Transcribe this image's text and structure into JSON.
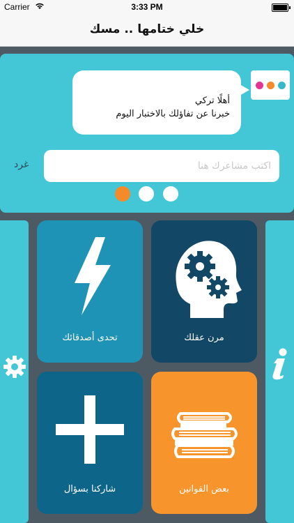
{
  "status_bar": {
    "carrier": "Carrier",
    "time": "3:33 PM"
  },
  "nav": {
    "title": "خلي ختامها .. مسك"
  },
  "feed": {
    "greeting": "أهلًا تركي",
    "message": "خبرنا عن تفاؤلك بالاختبار اليوم",
    "input_placeholder": "اكتب مشاعرك هنا",
    "input_value": "",
    "tweet_label": "غرد",
    "pager_total": 3,
    "pager_active": 1
  },
  "tiles": {
    "challenge_friends": "تحدى أصدقائك",
    "train_mind": "مرن عقلك",
    "ask_question": "شاركنا بسؤال",
    "some_rules": "بعض القوانين"
  },
  "colors": {
    "panel": "#43c7d6",
    "challenge_tile": "#1f93b6",
    "brain_tile": "#134766",
    "ask_tile": "#0d6689",
    "rules_tile": "#f7952c",
    "active_page_dot": "#f48a2a",
    "background": "#4d5a63"
  },
  "icons": {
    "left_sidebar": "gear-icon",
    "right_sidebar": "info-icon",
    "challenge": "lightning-icon",
    "brain": "brain-gears-icon",
    "ask": "plus-icon",
    "rules": "books-icon"
  }
}
